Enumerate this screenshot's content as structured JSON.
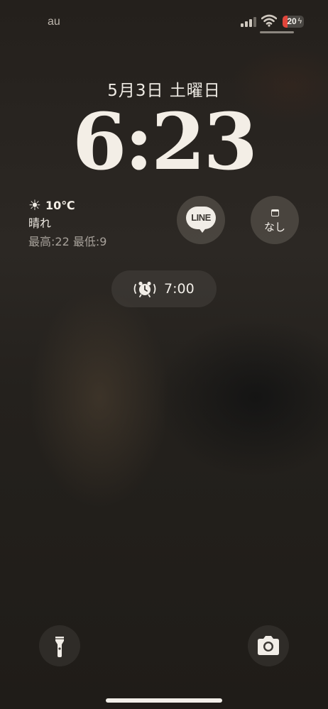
{
  "status_bar": {
    "carrier": "au",
    "battery_percent": "20",
    "charging": true,
    "signal_bars_active": 3,
    "signal_bars_total": 4,
    "icons": [
      "signal-icon",
      "wifi-icon",
      "battery-icon",
      "charging-bolt-icon"
    ]
  },
  "lock_screen": {
    "date": "5月3日 土曜日",
    "time": "6:23"
  },
  "widgets": {
    "weather": {
      "icon": "sun-icon",
      "temperature": "10℃",
      "condition": "晴れ",
      "high_low": "最高:22 最低:9"
    },
    "line": {
      "icon": "line-app-icon",
      "label": "LINE"
    },
    "calendar": {
      "icon": "calendar-icon",
      "text": "なし"
    }
  },
  "alarm": {
    "icon": "alarm-clock-icon",
    "time": "7:00"
  },
  "quick_actions": {
    "left": "flashlight-icon",
    "right": "camera-icon"
  },
  "colors": {
    "battery_low": "#e0453b",
    "text": "#f2efe9"
  }
}
